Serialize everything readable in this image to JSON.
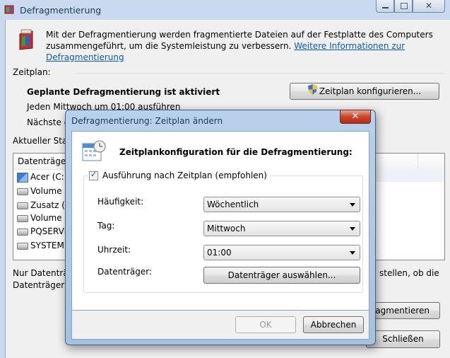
{
  "main_window": {
    "title": "Defragmentierung",
    "intro_text": "Mit der Defragmentierung werden fragmentierte Dateien auf der Festplatte des Computers zusammengeführt, um die Systemleistung zu verbessern.",
    "intro_link": "Weitere Informationen zur Defragmentierung",
    "schedule_section_label": "Zeitplan:",
    "schedule_status": "Geplante Defragmentierung ist aktiviert",
    "schedule_detail": "Jeden Mittwoch um 01:00 ausführen",
    "next_run_partial": "Nächste ge",
    "configure_button": "Zeitplan konfigurieren...",
    "current_status_partial": "Aktueller Statu",
    "column_header_partial": "Datenträger",
    "volumes": [
      "Acer (C:)",
      "Volume (E",
      "Zusatz (F:)",
      "Volume (",
      "PQSERVIC",
      "SYSTEM R"
    ],
    "note_left_line1": "Nur Datenträg",
    "note_left_line2": "Datenträger je",
    "note_right": "stellen, ob die",
    "defrag_button_partial": "agmentieren",
    "close_button": "Schließen"
  },
  "dialog": {
    "title": "Defragmentierung: Zeitplan ändern",
    "heading": "Zeitplankonfiguration für die Defragmentierung:",
    "checkbox_label": "Ausführung nach Zeitplan (empfohlen)",
    "checkbox_checked": true,
    "frequency_label": "Häufigkeit:",
    "frequency_value": "Wöchentlich",
    "day_label": "Tag:",
    "day_value": "Mittwoch",
    "time_label": "Uhrzeit:",
    "time_value": "01:00",
    "disks_label": "Datenträger:",
    "disks_button": "Datenträger auswählen...",
    "ok_button": "OK",
    "cancel_button": "Abbrechen"
  },
  "icons": {
    "app_icon": "defrag-icon",
    "shield": "uac-shield-icon",
    "calendar": "calendar-clock-icon",
    "drive": "drive-icon"
  },
  "colors": {
    "link": "#0a5ac2",
    "close_button": "#c7452a",
    "dialog_frame": "#b9d1ea"
  }
}
